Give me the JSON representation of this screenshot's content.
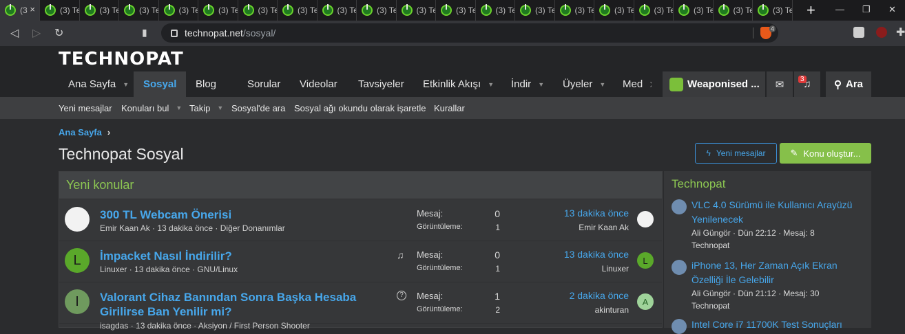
{
  "browser": {
    "tabs": [
      {
        "label": "(3",
        "active": true
      },
      {
        "label": "(3) Te"
      },
      {
        "label": "(3) Te"
      },
      {
        "label": "(3) Te"
      },
      {
        "label": "(3) Te"
      },
      {
        "label": "(3) Te"
      },
      {
        "label": "(3) Te"
      },
      {
        "label": "(3) Te"
      },
      {
        "label": "(3) Te"
      },
      {
        "label": "(3) Te"
      },
      {
        "label": "(3) Te"
      },
      {
        "label": "(3) Te"
      },
      {
        "label": "(3) Te"
      },
      {
        "label": "(3) Te"
      },
      {
        "label": "(3) Te"
      },
      {
        "label": "(3) Te"
      },
      {
        "label": "(3) Te"
      },
      {
        "label": "(3) Te"
      },
      {
        "label": "(3) Te"
      },
      {
        "label": "(3) Te"
      }
    ],
    "new_tab": "+",
    "close_tab": "×",
    "url_host": "technopat.net",
    "url_path": "/sosyal/",
    "brave_count": "4",
    "colors": {
      "tab_favicon": "#6bd22c",
      "brave": "#e8591a"
    }
  },
  "site": {
    "logo": "TECHNOPAT",
    "nav": [
      {
        "label": "Ana Sayfa",
        "caret": true
      },
      {
        "label": "Sosyal",
        "active": true
      },
      {
        "label": "Blog"
      },
      {
        "label": "Sorular"
      },
      {
        "label": "Videolar"
      },
      {
        "label": "Tavsiyeler"
      },
      {
        "label": "Etkinlik Akışı",
        "caret": true
      },
      {
        "label": "İndir",
        "caret": true
      },
      {
        "label": "Üyeler",
        "caret": true
      },
      {
        "label": "Med"
      }
    ],
    "user_name": "Weaponised ...",
    "alert_count": "3",
    "search_label": "Ara",
    "subnav": [
      "Yeni mesajlar",
      "Konuları bul",
      "Takip",
      "Sosyal'de ara",
      "Sosyal ağı okundu olarak işaretle",
      "Kurallar"
    ],
    "accent": "#47a7eb",
    "green": "#86c04a"
  },
  "page": {
    "breadcrumb": "Ana Sayfa",
    "breadcrumb_sep": "›",
    "title": "Technopat Sosyal",
    "btn_new_posts": "Yeni mesajlar",
    "btn_new_thread": "Konu oluştur..."
  },
  "new_threads": {
    "heading": "Yeni konular",
    "label_messages": "Mesaj:",
    "label_views": "Görüntüleme:",
    "rows": [
      {
        "title": "300 TL Webcam Önerisi",
        "meta": "Emir Kaan Ak · 13 dakika önce · Diğer Donanımlar",
        "messages": "0",
        "views": "1",
        "last_time": "13 dakika önce",
        "last_user": "Emir Kaan Ak",
        "avatar": "",
        "avatar_color": "#f2f2f2"
      },
      {
        "title": "İmpacket Nasıl İndirilir?",
        "meta": "Linuxer · 13 dakika önce · GNU/Linux",
        "messages": "0",
        "views": "1",
        "last_time": "13 dakika önce",
        "last_user": "Linuxer",
        "avatar": "L",
        "avatar_color": "#5aa82a",
        "icon": "bell-icon"
      },
      {
        "title": "Valorant Cihaz Banından Sonra Başka Hesaba Girilirse Ban Yenilir mi?",
        "meta": "isagdas · 13 dakika önce · Aksiyon / First Person Shooter",
        "messages": "1",
        "views": "2",
        "last_time": "2 dakika önce",
        "last_user": "akinturan",
        "avatar": "I",
        "avatar_color": "#6f9a5e",
        "mini_avatar": "A",
        "mini_color": "#9fd39a",
        "icon": "question-icon"
      }
    ]
  },
  "sidebar": {
    "heading": "Technopat",
    "items": [
      {
        "title": "VLC 4.0 Sürümü ile Kullanıcı Arayüzü Yenilenecek",
        "meta": "Ali Güngör · Dün 22:12 · Mesaj: 8",
        "forum": "Technopat"
      },
      {
        "title": "iPhone 13, Her Zaman Açık Ekran Özelliği İle Gelebilir",
        "meta": "Ali Güngör · Dün 21:12 · Mesaj: 30",
        "forum": "Technopat"
      },
      {
        "title": "Intel Core i7 11700K Test Sonuçları",
        "meta": "",
        "forum": ""
      }
    ]
  }
}
